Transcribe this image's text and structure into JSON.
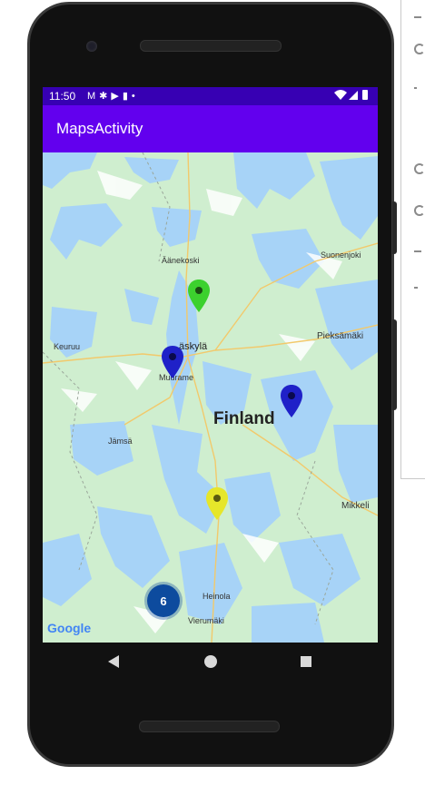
{
  "status_bar": {
    "time": "11:50",
    "left_icons": [
      "gmail-icon",
      "settings-icon",
      "youtube-icon",
      "sd-card-icon",
      "dot-icon"
    ],
    "right_icons": [
      "wifi-icon",
      "signal-icon",
      "battery-icon"
    ]
  },
  "app_bar": {
    "title": "MapsActivity"
  },
  "map": {
    "country": "Finland",
    "places": [
      {
        "name": "Äänekoski"
      },
      {
        "name": "Suonenjoki"
      },
      {
        "name": "Keuruu"
      },
      {
        "name": "Jyväskylä",
        "visible_text": "äskylä"
      },
      {
        "name": "Pieksämäki"
      },
      {
        "name": "Muurame"
      },
      {
        "name": "Jämsä"
      },
      {
        "name": "Mikkeli"
      },
      {
        "name": "Heinola"
      },
      {
        "name": "Vierumäki"
      }
    ],
    "markers": [
      {
        "name": "green-marker",
        "color": "#3cd12e"
      },
      {
        "name": "blue-marker-jyvaskyla",
        "color": "#1f21c8"
      },
      {
        "name": "blue-marker-east",
        "color": "#1f21c8"
      },
      {
        "name": "yellow-marker",
        "color": "#e6e62a"
      }
    ],
    "cluster": {
      "count": "6",
      "color": "#0d4b9e"
    },
    "attribution": "Google"
  },
  "colors": {
    "status_bar": "#3700b3",
    "app_bar": "#6200ee",
    "land": "#cfeecf",
    "water": "#a7d3f7"
  }
}
